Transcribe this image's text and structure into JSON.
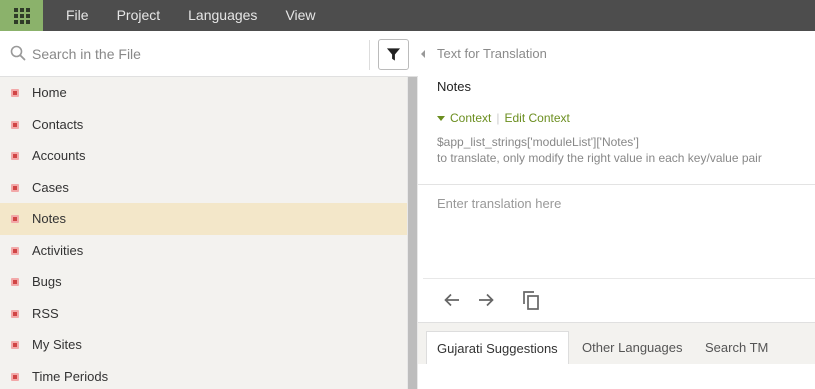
{
  "topbar": {
    "menu": [
      "File",
      "Project",
      "Languages",
      "View"
    ]
  },
  "search": {
    "placeholder": "Search in the File"
  },
  "strings_list": [
    {
      "label": "Home",
      "selected": false
    },
    {
      "label": "Contacts",
      "selected": false
    },
    {
      "label": "Accounts",
      "selected": false
    },
    {
      "label": "Cases",
      "selected": false
    },
    {
      "label": "Notes",
      "selected": true
    },
    {
      "label": "Activities",
      "selected": false
    },
    {
      "label": "Bugs",
      "selected": false
    },
    {
      "label": "RSS",
      "selected": false
    },
    {
      "label": "My Sites",
      "selected": false
    },
    {
      "label": "Time Periods",
      "selected": false
    }
  ],
  "editor": {
    "section_title": "Text for Translation",
    "source_text": "Notes",
    "context_label": "Context",
    "edit_context_label": "Edit Context",
    "context_key": "$app_list_strings['moduleList']['Notes']",
    "context_hint": "to translate, only modify the right value in each key/value pair",
    "translation_placeholder": "Enter translation here"
  },
  "tabs": [
    "Gujarati Suggestions",
    "Other Languages",
    "Search TM"
  ],
  "active_tab": "Gujarati Suggestions",
  "colors": {
    "topbar": "#4d4d4d",
    "apps_button": "#8bb26b",
    "selected_row": "#f3e7c9",
    "context_link": "#6b8e1f",
    "status_dot": "#d04545"
  },
  "icons": {
    "apps": "apps-grid-icon",
    "search": "search-icon",
    "filter": "filter-icon",
    "collapse": "collapse-left-icon",
    "context_toggle": "caret-down-icon",
    "previous": "arrow-left-icon",
    "next": "arrow-right-icon",
    "copy": "copy-source-icon",
    "row_status": "untranslated-status-icon"
  }
}
